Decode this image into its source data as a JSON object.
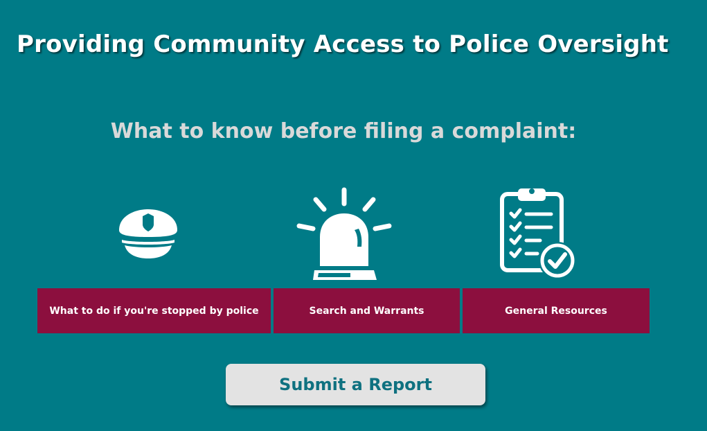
{
  "page": {
    "title": "Providing Community Access to Police Oversight",
    "subtitle": "What to know before filing a complaint:"
  },
  "topics": [
    {
      "icon": "police-cap-icon",
      "label": "What to do if you're stopped by police"
    },
    {
      "icon": "siren-light-icon",
      "label": "Search and Warrants"
    },
    {
      "icon": "clipboard-checklist-icon",
      "label": "General Resources"
    }
  ],
  "actions": {
    "submit_label": "Submit a Report"
  },
  "colors": {
    "background": "#007b87",
    "tile": "#8c0f3e",
    "title_text": "#ffffff",
    "subtitle_text": "#d9d9d9",
    "button_bg": "#e3e3e3",
    "button_text": "#0f7180"
  }
}
